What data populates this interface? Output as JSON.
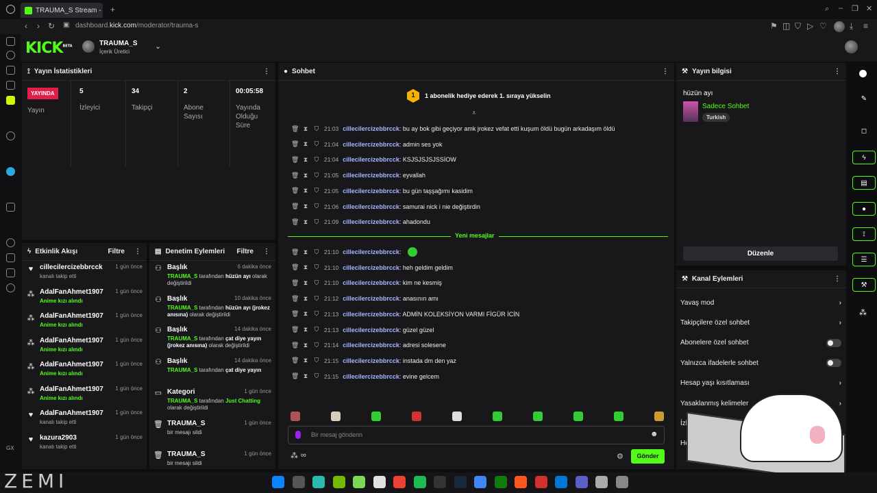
{
  "browser": {
    "tab_title": "TRAUMA_S Stream - Kick",
    "url_prefix": "dashboard.",
    "url_domain": "kick.com",
    "url_path": "/moderator/trauma-s"
  },
  "header": {
    "logo": "KICK",
    "logo_badge": "BETA",
    "channel_name": "TRAUMA_S",
    "channel_role": "İçerik Üretici"
  },
  "stats": {
    "title": "Yayın İstatistikleri",
    "live_badge": "YAYINDA",
    "live_label": "Yayın",
    "items": [
      {
        "value": "5",
        "label": "İzleyici"
      },
      {
        "value": "34",
        "label": "Takipçi"
      },
      {
        "value": "2",
        "label": "Abone Sayısı"
      },
      {
        "value": "00:05:58",
        "label": "Yayında Olduğu Süre"
      }
    ]
  },
  "activity": {
    "title": "Etkinlik Akışı",
    "filter": "Filtre",
    "items": [
      {
        "icon": "heart",
        "name": "cillecilercizebbrcck",
        "sub": "kanalı takip etti",
        "time": "1 gün önce",
        "green": false
      },
      {
        "icon": "share",
        "name": "AdalFanAhmet1907",
        "sub": "Anime kızı alındı",
        "time": "1 gün önce",
        "green": true
      },
      {
        "icon": "share",
        "name": "AdalFanAhmet1907",
        "sub": "Anime kızı alındı",
        "time": "1 gün önce",
        "green": true
      },
      {
        "icon": "share",
        "name": "AdalFanAhmet1907",
        "sub": "Anime kızı alındı",
        "time": "1 gün önce",
        "green": true
      },
      {
        "icon": "share",
        "name": "AdalFanAhmet1907",
        "sub": "Anime kızı alındı",
        "time": "1 gün önce",
        "green": true
      },
      {
        "icon": "share",
        "name": "AdalFanAhmet1907",
        "sub": "Anime kızı alındı",
        "time": "1 gün önce",
        "green": true
      },
      {
        "icon": "heart",
        "name": "AdalFanAhmet1907",
        "sub": "kanalı takip etti",
        "time": "1 gün önce",
        "green": false
      },
      {
        "icon": "heart",
        "name": "kazura2903",
        "sub": "kanalı takip etti",
        "time": "1 gün önce",
        "green": false
      }
    ]
  },
  "moderation": {
    "title": "Denetim Eylemleri",
    "filter": "Filtre",
    "items": [
      {
        "name": "Başlık",
        "time": "6 dakika önce",
        "actor": "TRAUMA_S",
        "mid": " tarafından ",
        "value": "hüzün ayı",
        "rest": " olarak değiştirildi"
      },
      {
        "name": "Başlık",
        "time": "10 dakika önce",
        "actor": "TRAUMA_S",
        "mid": " tarafından ",
        "value": "hüzün ayı (jrokez anısına)",
        "rest": " olarak değiştirildi"
      },
      {
        "name": "Başlık",
        "time": "14 dakika önce",
        "actor": "TRAUMA_S",
        "mid": " tarafından ",
        "value": "çat diye yayın (jrokez anısına)",
        "rest": " olarak değiştirildi"
      },
      {
        "name": "Başlık",
        "time": "14 dakika önce",
        "actor": "TRAUMA_S",
        "mid": " tarafından ",
        "value": "çat diye yayın",
        "rest": ""
      },
      {
        "name": "Kategori",
        "time": "1 gün önce",
        "actor": "TRAUMA_S",
        "mid": " tarafından ",
        "value": "Just Chatting",
        "rest": " olarak değiştirildi"
      },
      {
        "name": "TRAUMA_S",
        "time": "1 gün önce",
        "actor": "",
        "mid": "bir mesajı sildi",
        "value": "",
        "rest": ""
      },
      {
        "name": "TRAUMA_S",
        "time": "1 gün önce",
        "actor": "",
        "mid": "bir mesajı sildi",
        "value": "",
        "rest": ""
      }
    ]
  },
  "chat": {
    "title": "Sohbet",
    "pinned_rank": "1",
    "pinned_text": "1 abonelik hediye ederek 1. sıraya yükselin",
    "new_messages": "Yeni mesajlar",
    "messages": [
      {
        "time": "21:03",
        "user": "cillecilercizebbrcck",
        "text": ": bu ay bok gibi geçiyor amk jrokez vefat etti kuşum öldü bugün arkadaşım öldü"
      },
      {
        "time": "21:04",
        "user": "cillecilercizebbrcck",
        "text": ": admin ses yok"
      },
      {
        "time": "21:04",
        "user": "cillecilercizebbrcck",
        "text": ": KSJSJSJSJSSİOW"
      },
      {
        "time": "21:05",
        "user": "cillecilercizebbrcck",
        "text": ": eyvallah"
      },
      {
        "time": "21:05",
        "user": "cillecilercizebbrcck",
        "text": ": bu gün taşşağımı kasidim"
      },
      {
        "time": "21:06",
        "user": "cillecilercizebbrcck",
        "text": ": samurai nick i nie değiştirdin"
      },
      {
        "time": "21:09",
        "user": "cillecilercizebbrcck",
        "text": ": ahadondu"
      }
    ],
    "new": [
      {
        "time": "21:10",
        "user": "cillecilercizebbrcck",
        "text": ":"
      },
      {
        "time": "21:10",
        "user": "cillecilercizebbrcck",
        "text": ": heh geldim geldim"
      },
      {
        "time": "21:10",
        "user": "cillecilercizebbrcck",
        "text": ": kim ne kesmiş"
      },
      {
        "time": "21:12",
        "user": "cillecilercizebbrcck",
        "text": ": anasının amı"
      },
      {
        "time": "21:13",
        "user": "cillecilercizebbrcck",
        "text": ": ADMİN KOLEKSİYON VARMI FİGÜR İCİN"
      },
      {
        "time": "21:13",
        "user": "cillecilercizebbrcck",
        "text": ": güzel güzel"
      },
      {
        "time": "21:14",
        "user": "cillecilercizebbrcck",
        "text": ": adresi solesene"
      },
      {
        "time": "21:15",
        "user": "cillecilercizebbrcck",
        "text": ": instada dm den yaz"
      },
      {
        "time": "21:15",
        "user": "cillecilercizebbrcck",
        "text": ": evine gelcem"
      }
    ],
    "input_placeholder": "Bir mesaj gönderin",
    "send": "Gönder"
  },
  "stream_info": {
    "title": "Yayın bilgisi",
    "stream_title": "hüzün ayı",
    "category": "Sadece Sohbet",
    "language": "Turkish",
    "edit": "Düzenle"
  },
  "channel_actions": {
    "title": "Kanal Eylemleri",
    "items": [
      {
        "label": "Yavaş mod",
        "kind": "arrow"
      },
      {
        "label": "Takipçilere özel sohbet",
        "kind": "arrow"
      },
      {
        "label": "Abonelere özel sohbet",
        "kind": "toggle"
      },
      {
        "label": "Yalnızca ifadelerle sohbet",
        "kind": "toggle"
      },
      {
        "label": "Hesap yaşı kısıtlaması",
        "kind": "arrow"
      },
      {
        "label": "Yasaklanmış kelimeler",
        "kind": "arrow"
      },
      {
        "label": "İzleyici Yönlendi",
        "kind": "none"
      },
      {
        "label": "He",
        "kind": "none"
      }
    ]
  },
  "colors": {
    "accent": "#53fc18",
    "live": "#e11d48",
    "username": "#a5b8ff"
  }
}
